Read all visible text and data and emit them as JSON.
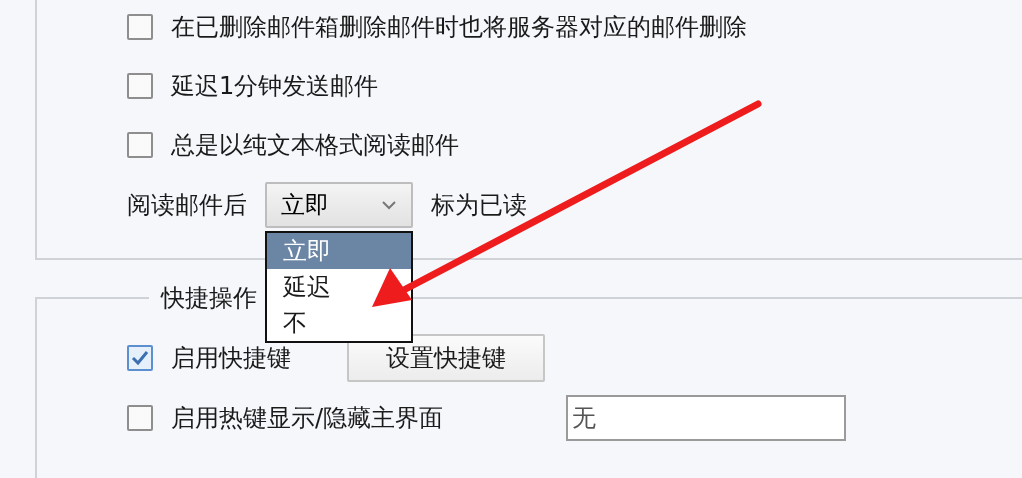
{
  "options": [
    {
      "label": "在已删除邮件箱删除邮件时也将服务器对应的邮件删除",
      "checked": false
    },
    {
      "label": "延迟1分钟发送邮件",
      "checked": false
    },
    {
      "label": "总是以纯文本格式阅读邮件",
      "checked": false
    }
  ],
  "mark_read": {
    "label": "阅读邮件后",
    "value": "立即",
    "suffix": "标为已读",
    "expanded": true,
    "options": [
      {
        "label": "立即",
        "selected": true
      },
      {
        "label": "延迟",
        "selected": false
      },
      {
        "label": "不",
        "selected": false
      }
    ]
  },
  "shortcuts": {
    "title": "快捷操作",
    "enable": {
      "label": "启用快捷键",
      "checked": true
    },
    "button": "设置快捷键",
    "hotkey": {
      "label": "启用热键显示/隐藏主界面",
      "checked": false,
      "value": "无"
    }
  }
}
